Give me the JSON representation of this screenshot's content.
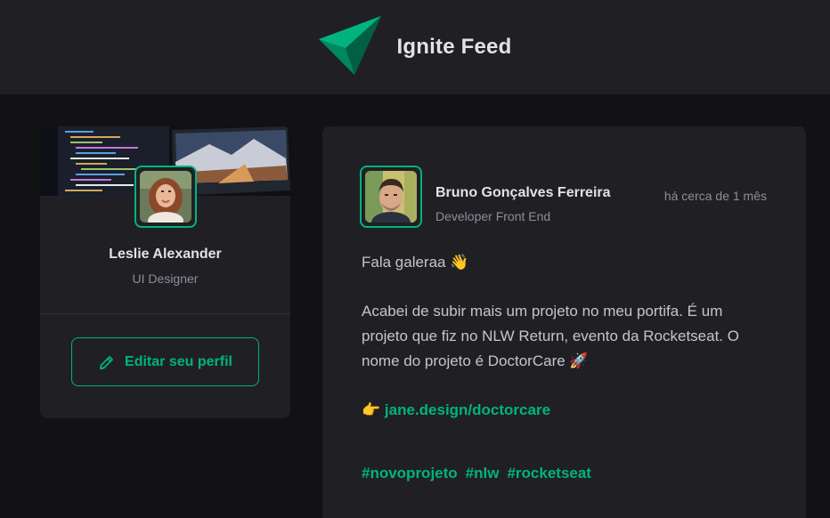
{
  "app": {
    "title": "Ignite Feed",
    "logo_icon": "ignite-paper-plane-logo"
  },
  "colors": {
    "accent": "#00b37e",
    "background": "#121214",
    "card": "#202024",
    "title": "#e1e1e6",
    "muted": "#8d8d99",
    "text": "#c4c4cc"
  },
  "profile": {
    "name": "Leslie Alexander",
    "role": "UI Designer",
    "edit_label": "Editar seu perfil",
    "edit_icon": "pencil-icon"
  },
  "post": {
    "author_name": "Bruno Gonçalves Ferreira",
    "author_role": "Developer Front End",
    "time": "há cerca de 1 mês",
    "greeting": "Fala galeraa 👋",
    "body": "Acabei de subir mais um projeto no meu portifa. É um projeto que fiz no NLW Return, evento da Rocketseat. O nome do projeto é DoctorCare 🚀",
    "link_emoji": "👉",
    "link_text": "jane.design/doctorcare",
    "tags": [
      "#novoprojeto",
      "#nlw",
      "#rocketseat"
    ]
  }
}
